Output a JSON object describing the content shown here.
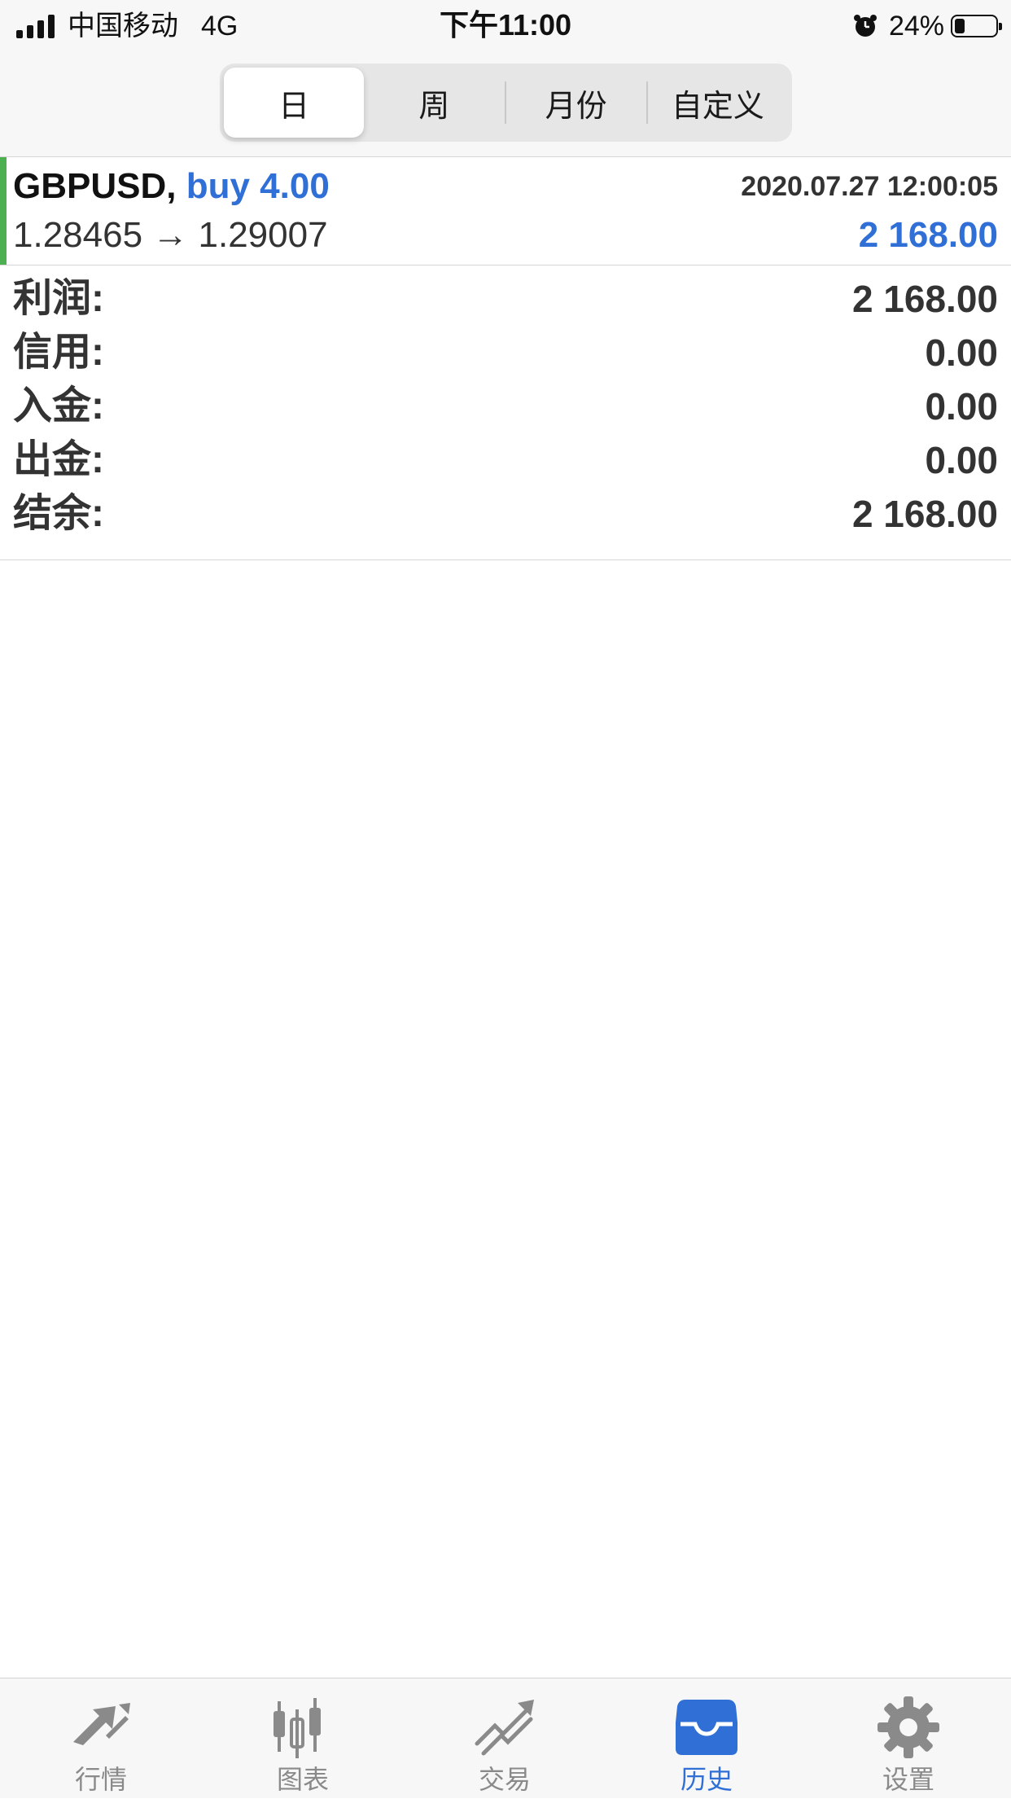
{
  "status_bar": {
    "carrier": "中国移动",
    "network": "4G",
    "time": "下午11:00",
    "battery": "24%",
    "battery_level": 0.24,
    "icons": [
      "signal-icon",
      "alarm-icon",
      "battery-icon"
    ]
  },
  "period_tabs": {
    "items": [
      {
        "label": "日",
        "active": true
      },
      {
        "label": "周",
        "active": false
      },
      {
        "label": "月份",
        "active": false
      },
      {
        "label": "自定义",
        "active": false
      }
    ]
  },
  "deal": {
    "symbol": "GBPUSD,",
    "side": "buy 4.00",
    "time": "2020.07.27 12:00:05",
    "prices": "1.28465 → 1.29007",
    "profit": "2 168.00",
    "colors": {
      "buy": "#2f6fd6",
      "indicator": "#4caf50"
    }
  },
  "summary": {
    "rows": [
      {
        "label": "利润:",
        "value": "2 168.00"
      },
      {
        "label": "信用:",
        "value": "0.00"
      },
      {
        "label": "入金:",
        "value": "0.00"
      },
      {
        "label": "出金:",
        "value": "0.00"
      },
      {
        "label": "结余:",
        "value": "2 168.00"
      }
    ]
  },
  "tab_bar": {
    "items": [
      {
        "label": "行情",
        "icon": "quotes-icon",
        "active": false
      },
      {
        "label": "图表",
        "icon": "chart-icon",
        "active": false
      },
      {
        "label": "交易",
        "icon": "trade-icon",
        "active": false
      },
      {
        "label": "历史",
        "icon": "history-icon",
        "active": true
      },
      {
        "label": "设置",
        "icon": "settings-icon",
        "active": false
      }
    ],
    "colors": {
      "active": "#2f6fd6",
      "inactive": "#8a8a8a"
    }
  }
}
